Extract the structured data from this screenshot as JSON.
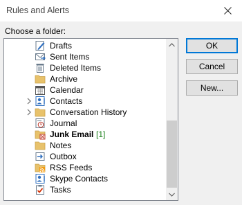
{
  "window": {
    "title": "Rules and Alerts"
  },
  "choose_label": "Choose a folder:",
  "folders": [
    {
      "label": "Drafts",
      "icon": "drafts-icon"
    },
    {
      "label": "Sent Items",
      "icon": "sent-items-icon"
    },
    {
      "label": "Deleted Items",
      "icon": "deleted-items-icon"
    },
    {
      "label": "Archive",
      "icon": "archive-folder-icon"
    },
    {
      "label": "Calendar",
      "icon": "calendar-icon"
    },
    {
      "label": "Contacts",
      "icon": "contacts-icon",
      "expandable": true
    },
    {
      "label": "Conversation History",
      "icon": "folder-icon",
      "expandable": true
    },
    {
      "label": "Journal",
      "icon": "journal-icon"
    },
    {
      "label": "Junk Email",
      "icon": "junk-email-icon",
      "bold": true,
      "count": "[1]"
    },
    {
      "label": "Notes",
      "icon": "notes-icon"
    },
    {
      "label": "Outbox",
      "icon": "outbox-icon"
    },
    {
      "label": "RSS Feeds",
      "icon": "rss-feeds-icon"
    },
    {
      "label": "Skype Contacts",
      "icon": "skype-contacts-icon"
    },
    {
      "label": "Tasks",
      "icon": "tasks-icon"
    }
  ],
  "buttons": {
    "ok": "OK",
    "cancel": "Cancel",
    "new": "New..."
  },
  "colors": {
    "folder": "#e8c26b",
    "accent": "#0078d7",
    "count": "#1a7f1a"
  }
}
